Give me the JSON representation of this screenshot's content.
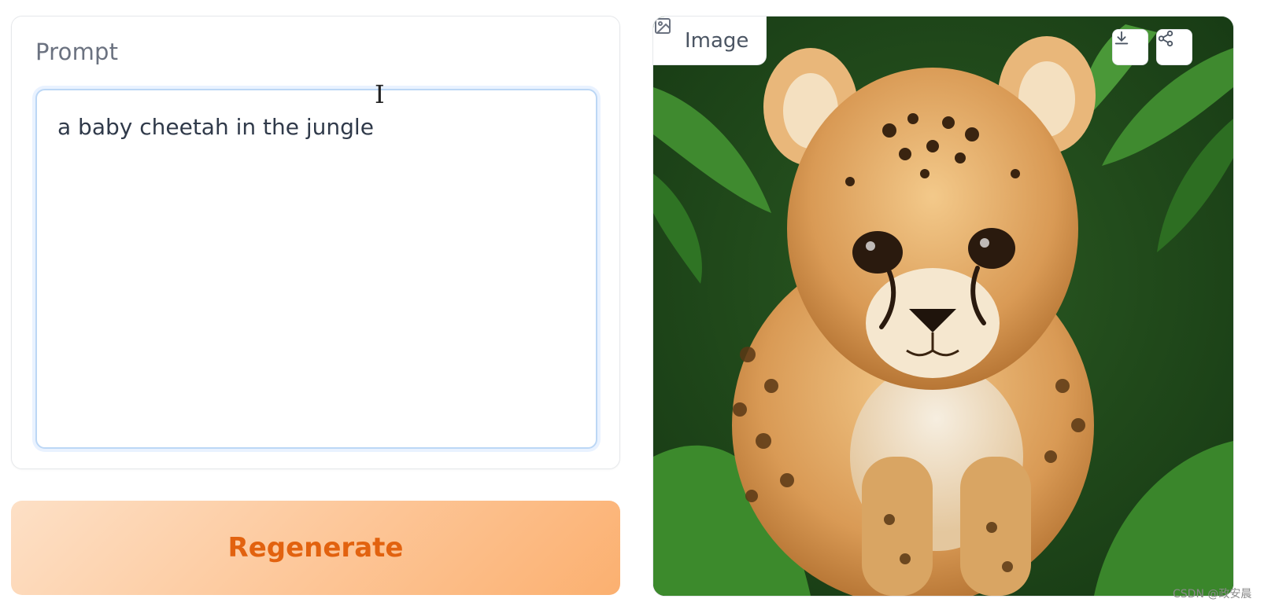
{
  "prompt": {
    "label": "Prompt",
    "value": "a baby cheetah in the jungle"
  },
  "actions": {
    "regenerate_label": "Regenerate"
  },
  "output": {
    "label": "Image",
    "image_icon": "image-icon",
    "download_icon": "download-icon",
    "share_icon": "share-icon"
  },
  "watermark": "CSDN @政安晨",
  "colors": {
    "accent": "#e2620f",
    "focus_border": "#bcd7f5"
  }
}
